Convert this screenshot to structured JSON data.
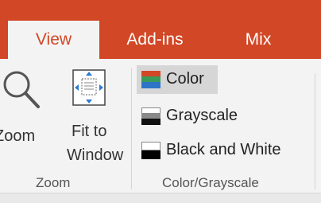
{
  "tabs": [
    {
      "label": "View",
      "active": true
    },
    {
      "label": "Add-ins",
      "active": false
    },
    {
      "label": "Mix",
      "active": false
    }
  ],
  "zoom_group": {
    "label": "Zoom",
    "zoom_button": {
      "label": "Zoom",
      "icon": "magnifier-icon"
    },
    "fit_button": {
      "line1": "Fit to",
      "line2": "Window",
      "icon": "fit-to-window-icon"
    }
  },
  "color_group": {
    "label": "Color/Grayscale",
    "items": [
      {
        "label": "Color",
        "icon": "color-swatch-icon",
        "selected": true
      },
      {
        "label": "Grayscale",
        "icon": "grayscale-swatch-icon",
        "selected": false
      },
      {
        "label": "Black and White",
        "icon": "black-white-swatch-icon",
        "selected": false
      }
    ]
  },
  "colors": {
    "accent": "#d24726",
    "ribbon": "#f3f3f3",
    "selected": "#d6d6d6"
  }
}
